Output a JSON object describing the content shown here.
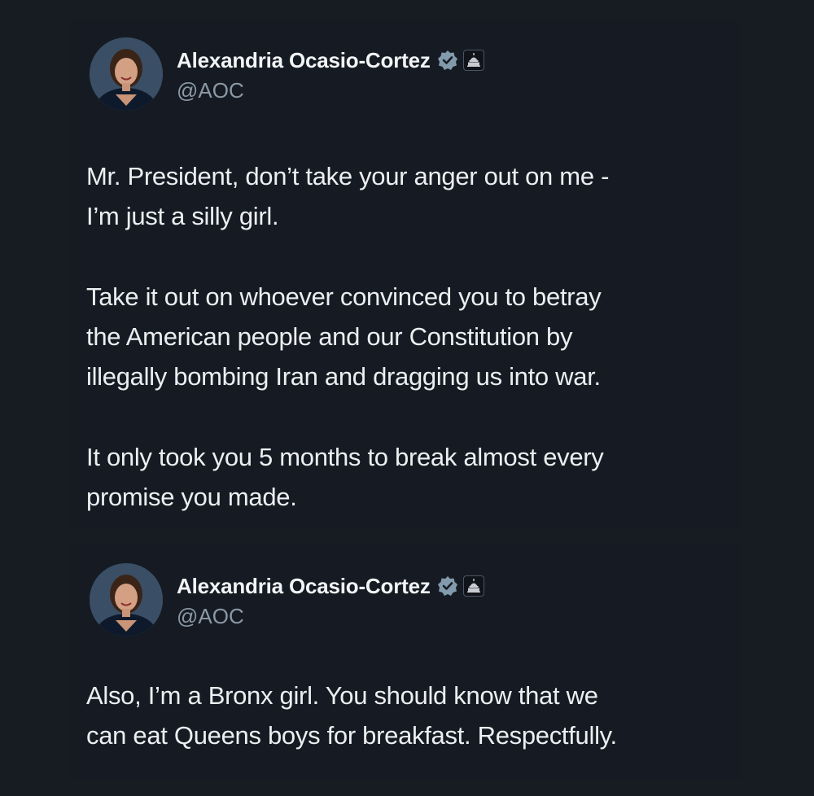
{
  "tweets": [
    {
      "author": {
        "name": "Alexandria Ocasio-Cortez",
        "handle": "@AOC",
        "verified_icon": "verified-badge-icon",
        "affiliation_icon": "capitol-building-icon"
      },
      "paragraphs": [
        [
          "Mr. President, don’t take your anger out on me -",
          "I’m just a silly girl."
        ],
        [
          "Take it out on whoever convinced you to betray",
          "the American people and our Constitution by",
          "illegally bombing Iran and dragging us into war."
        ],
        [
          "It only took you 5 months to break almost every",
          "promise you made."
        ]
      ]
    },
    {
      "author": {
        "name": "Alexandria Ocasio-Cortez",
        "handle": "@AOC",
        "verified_icon": "verified-badge-icon",
        "affiliation_icon": "capitol-building-icon"
      },
      "paragraphs": [
        [
          "Also, I’m a Bronx girl. You should know that we",
          "can eat Queens boys for breakfast. Respectfully."
        ]
      ]
    }
  ],
  "colors": {
    "background": "#171b22",
    "text": "#eceef0",
    "handle": "#8b98a5",
    "verified_badge": "#829aab"
  }
}
